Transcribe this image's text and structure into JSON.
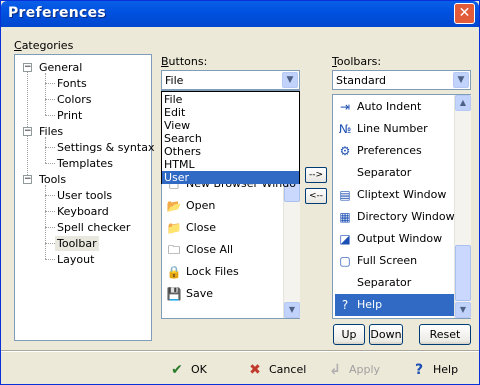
{
  "window": {
    "title": "Preferences",
    "close_glyph": "✕"
  },
  "categories": {
    "label_u": "C",
    "label_rest": "ategories",
    "nodes": [
      {
        "label": "General",
        "level": 0,
        "expander": "−"
      },
      {
        "label": "Fonts",
        "level": 1
      },
      {
        "label": "Colors",
        "level": 1
      },
      {
        "label": "Print",
        "level": 1
      },
      {
        "label": "Files",
        "level": 0,
        "expander": "−"
      },
      {
        "label": "Settings & syntax",
        "level": 1
      },
      {
        "label": "Templates",
        "level": 1
      },
      {
        "label": "Tools",
        "level": 0,
        "expander": "−"
      },
      {
        "label": "User tools",
        "level": 1
      },
      {
        "label": "Keyboard",
        "level": 1
      },
      {
        "label": "Spell checker",
        "level": 1
      },
      {
        "label": "Toolbar",
        "level": 1,
        "selected": true
      },
      {
        "label": "Layout",
        "level": 1
      }
    ]
  },
  "buttons": {
    "label_u": "B",
    "label_rest": "uttons:",
    "combo_value": "File",
    "dropdown_options": [
      "File",
      "Edit",
      "View",
      "Search",
      "Others",
      "HTML",
      "User"
    ],
    "dropdown_selected": "User",
    "items": [
      {
        "icon": "document-icon",
        "glyph": "🗋",
        "label": "New Browser Windo"
      },
      {
        "icon": "open-folder-icon",
        "glyph": "📂",
        "label": "Open"
      },
      {
        "icon": "close-folder-icon",
        "glyph": "📁",
        "label": "Close"
      },
      {
        "icon": "close-all-icon",
        "glyph": "🗀",
        "label": "Close All"
      },
      {
        "icon": "lock-icon",
        "glyph": "🔒",
        "label": "Lock Files"
      },
      {
        "icon": "save-icon",
        "glyph": "💾",
        "label": "Save"
      }
    ]
  },
  "move": {
    "add": "-->",
    "remove": "<--"
  },
  "toolbars": {
    "label_u": "T",
    "label_rest": "oolbars:",
    "combo_value": "Standard",
    "items": [
      {
        "icon": "auto-indent-icon",
        "glyph": "⇥",
        "label": "Auto Indent"
      },
      {
        "icon": "line-number-icon",
        "glyph": "№",
        "label": "Line Number"
      },
      {
        "icon": "preferences-icon",
        "glyph": "⚙",
        "label": "Preferences"
      },
      {
        "icon": "",
        "glyph": "",
        "label": "Separator"
      },
      {
        "icon": "cliptext-window-icon",
        "glyph": "▤",
        "label": "Cliptext Window"
      },
      {
        "icon": "directory-window-icon",
        "glyph": "▦",
        "label": "Directory Window"
      },
      {
        "icon": "output-window-icon",
        "glyph": "◪",
        "label": "Output Window"
      },
      {
        "icon": "full-screen-icon",
        "glyph": "▢",
        "label": "Full Screen"
      },
      {
        "icon": "",
        "glyph": "",
        "label": "Separator"
      },
      {
        "icon": "help-icon",
        "glyph": "?",
        "label": "Help",
        "selected": true
      }
    ],
    "up": "Up",
    "down": "Down",
    "reset": "Reset"
  },
  "footer": {
    "ok": "OK",
    "cancel": "Cancel",
    "apply": "Apply",
    "help": "Help"
  },
  "colors": {
    "selection": "#316ac5",
    "title_bar": "#0054e3",
    "dialog_bg": "#ece9d8"
  }
}
